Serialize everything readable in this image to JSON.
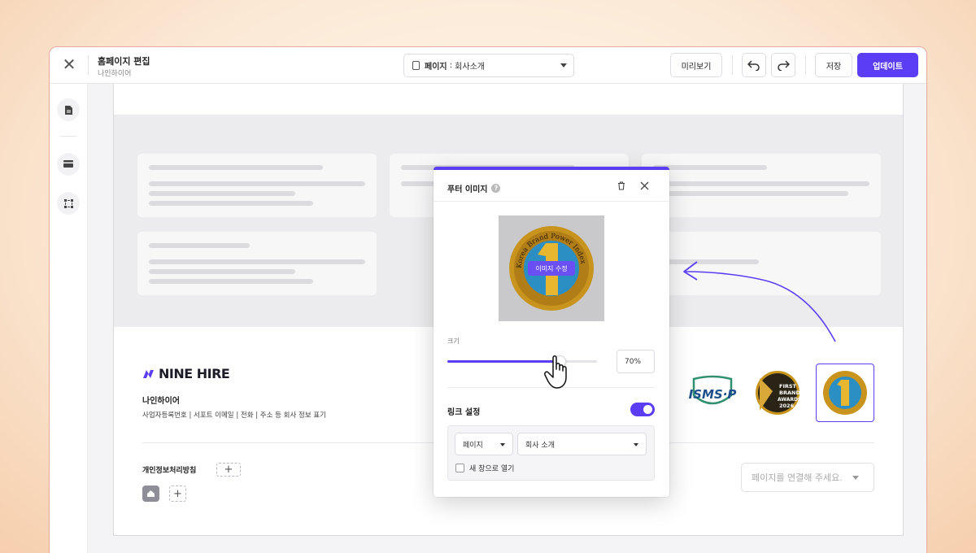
{
  "editor": {
    "title": "홈페이지 편집",
    "subtitle": "나인하이어",
    "page_selector": {
      "prefix": "페이지",
      "value": "회사소개"
    },
    "buttons": {
      "preview": "미리보기",
      "save": "저장",
      "update": "업데이트"
    }
  },
  "footer": {
    "brand_logo": "NINE HIRE",
    "company_name": "나인하이어",
    "info_line": "사업자등록번호 | 서포트 이메일 | 전화 | 주소 등 회사 정보 표기",
    "privacy_label": "개인정보처리방침",
    "link_placeholder": "페이지를 연결해 주세요.",
    "badges": [
      {
        "name": "ISMS-P",
        "label": "ISMS·P"
      },
      {
        "name": "First Brand Awards 2026",
        "label": "FIRST BRAND AWARDS 2026"
      },
      {
        "name": "Korea Brand Power Index",
        "label": "Korea Brand Power Index"
      }
    ]
  },
  "popup": {
    "title": "푸터 이미지",
    "edit_image": "이미지 수정",
    "image_seal_text": "Korea Brand Power Index",
    "size_label": "크기",
    "size_value": "70%",
    "size_percent": 70,
    "link_settings_label": "링크 설정",
    "link_enabled": true,
    "link_type": "페이지",
    "link_target": "회사 소개",
    "new_window_label": "새 창으로 열기",
    "new_window_checked": false
  },
  "colors": {
    "accent": "#5b3df5",
    "gold": "#c8941e"
  }
}
